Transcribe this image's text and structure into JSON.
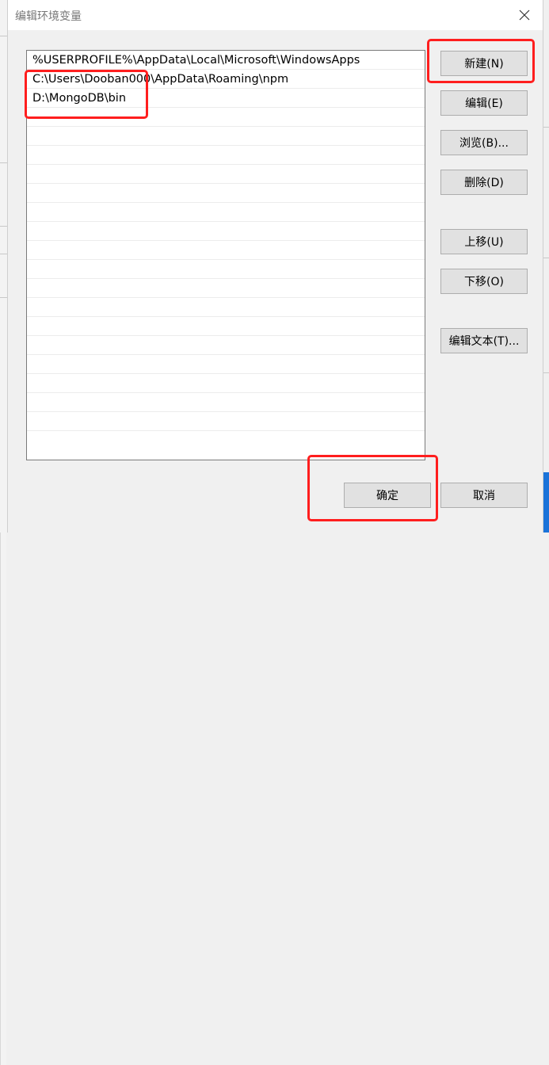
{
  "window": {
    "title": "编辑环境变量"
  },
  "paths": [
    "%USERPROFILE%\\AppData\\Local\\Microsoft\\WindowsApps",
    "C:\\Users\\Dooban000\\AppData\\Roaming\\npm",
    "D:\\MongoDB\\bin"
  ],
  "buttons": {
    "new": "新建(N)",
    "edit": "编辑(E)",
    "browse": "浏览(B)...",
    "delete": "删除(D)",
    "move_up": "上移(U)",
    "move_down": "下移(O)",
    "edit_text": "编辑文本(T)...",
    "ok": "确定",
    "cancel": "取消"
  },
  "colors": {
    "highlight": "#ff1e1e",
    "button_face": "#e1e1e1",
    "dialog_bg": "#f0f0f0"
  }
}
